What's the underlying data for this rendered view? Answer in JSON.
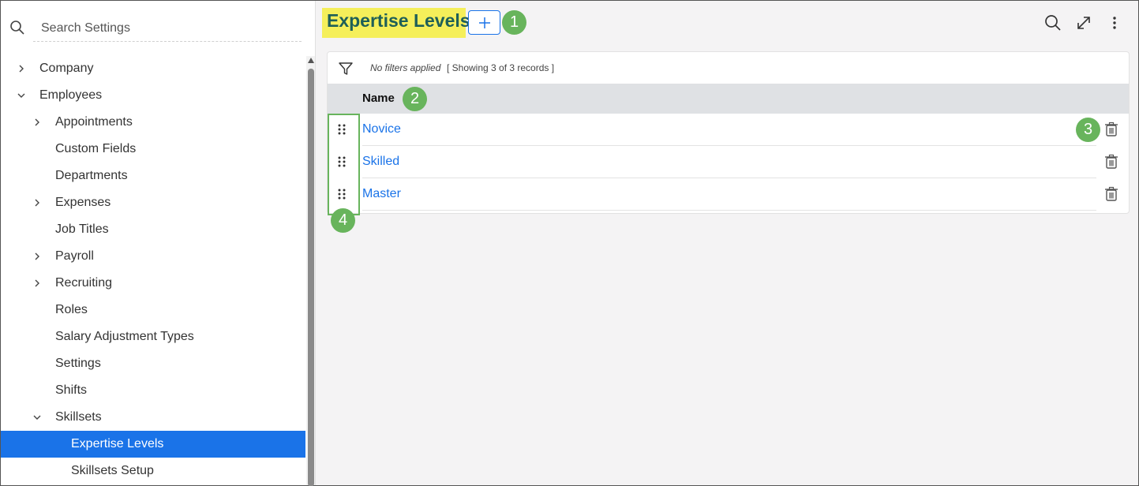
{
  "sidebar": {
    "search_placeholder": "Search Settings",
    "items": [
      {
        "label": "Company",
        "level": 0,
        "chevron": "right"
      },
      {
        "label": "Employees",
        "level": 0,
        "chevron": "down"
      },
      {
        "label": "Appointments",
        "level": 1,
        "chevron": "right"
      },
      {
        "label": "Custom Fields",
        "level": 1,
        "chevron": ""
      },
      {
        "label": "Departments",
        "level": 1,
        "chevron": ""
      },
      {
        "label": "Expenses",
        "level": 1,
        "chevron": "right"
      },
      {
        "label": "Job Titles",
        "level": 1,
        "chevron": ""
      },
      {
        "label": "Payroll",
        "level": 1,
        "chevron": "right"
      },
      {
        "label": "Recruiting",
        "level": 1,
        "chevron": "right"
      },
      {
        "label": "Roles",
        "level": 1,
        "chevron": ""
      },
      {
        "label": "Salary Adjustment Types",
        "level": 1,
        "chevron": ""
      },
      {
        "label": "Settings",
        "level": 1,
        "chevron": ""
      },
      {
        "label": "Shifts",
        "level": 1,
        "chevron": ""
      },
      {
        "label": "Skillsets",
        "level": 1,
        "chevron": "down"
      },
      {
        "label": "Expertise Levels",
        "level": 2,
        "chevron": "",
        "active": true
      },
      {
        "label": "Skillsets Setup",
        "level": 2,
        "chevron": ""
      }
    ]
  },
  "main": {
    "title": "Expertise Levels",
    "filter_text": "No filters applied",
    "records_text": "[ Showing 3 of 3 records ]",
    "column_header": "Name",
    "rows": [
      {
        "name": "Novice"
      },
      {
        "name": "Skilled"
      },
      {
        "name": "Master"
      }
    ]
  },
  "badges": {
    "b1": "1",
    "b2": "2",
    "b3": "3",
    "b4": "4"
  },
  "colors": {
    "accent": "#1a73e8",
    "title": "#1e5f58",
    "highlight": "#f5ef5a",
    "badge": "#68b45c"
  },
  "icons": [
    "search-icon",
    "chevron-right-icon",
    "chevron-down-icon",
    "plus-icon",
    "expand-icon",
    "more-vertical-icon",
    "filter-icon",
    "drag-handle-icon",
    "trash-icon"
  ]
}
